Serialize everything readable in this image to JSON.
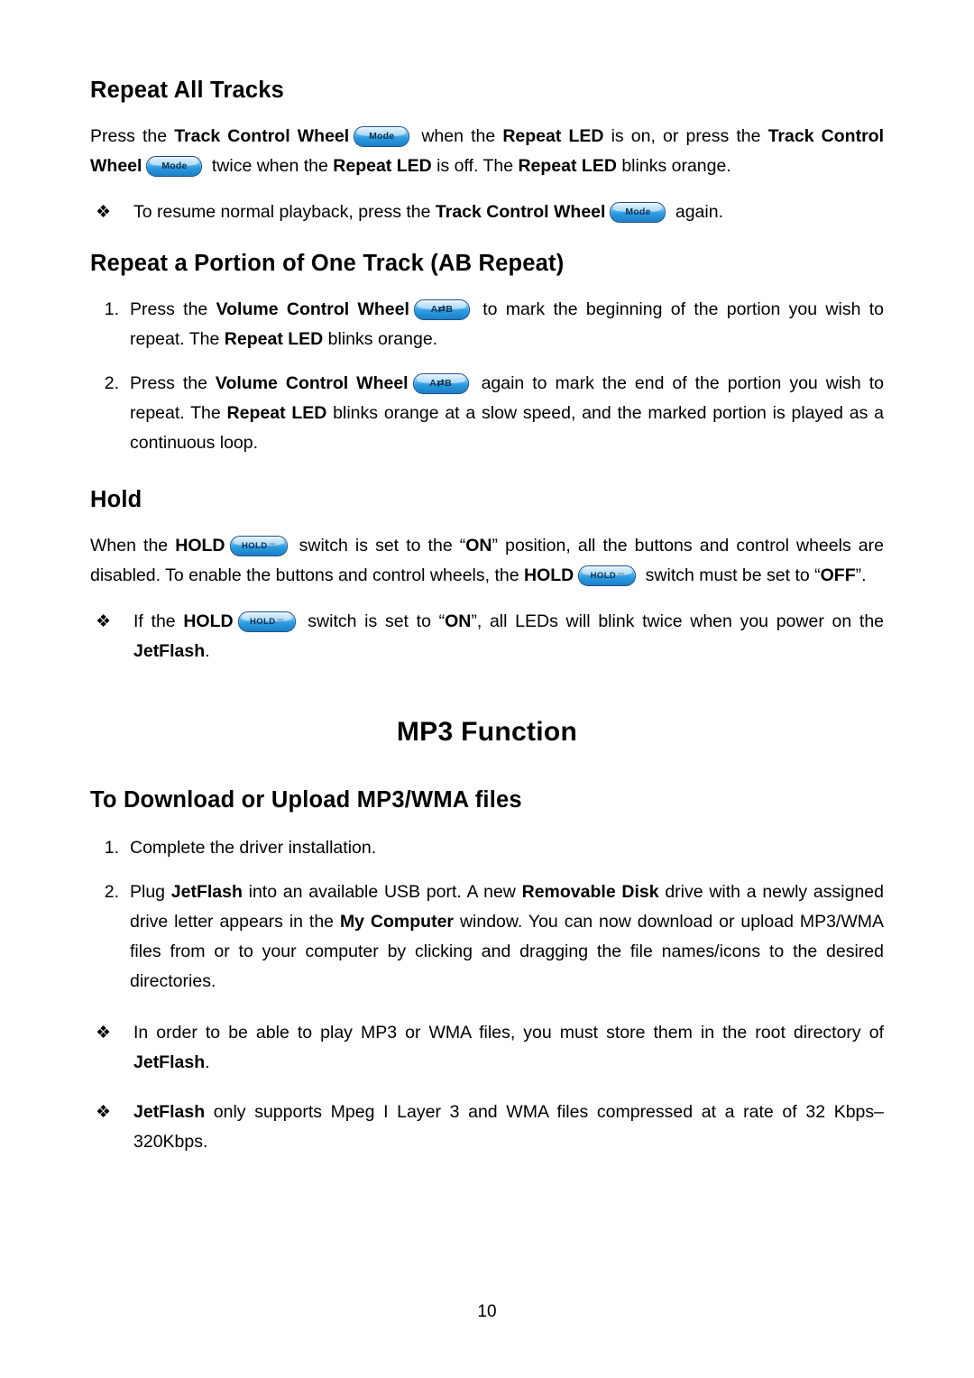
{
  "page": {
    "number": "10"
  },
  "sections": {
    "repeat_all": {
      "title": "Repeat All Tracks",
      "para1_a": "Press the ",
      "para1_b": "Track Control Wheel",
      "para1_c": " when the ",
      "para1_d": "Repeat LED",
      "para1_e": " is on, or press the ",
      "para1_f": "Track Control Wheel",
      "para1_g": " twice when the ",
      "para1_h": "Repeat LED",
      "para1_i": " is off. The ",
      "para1_j": "Repeat LED",
      "para1_k": " blinks orange.",
      "bullet1_a": "To resume normal playback, press the ",
      "bullet1_b": "Track Control Wheel",
      "bullet1_c": " again."
    },
    "ab_repeat": {
      "title": "Repeat a Portion of One Track (AB Repeat)",
      "item1_num": "1.",
      "item1_a": "Press the ",
      "item1_b": "Volume Control Wheel",
      "item1_c": " to mark the beginning of the portion you wish to repeat. The ",
      "item1_d": "Repeat LED",
      "item1_e": " blinks orange.",
      "item2_num": "2.",
      "item2_a": "Press the ",
      "item2_b": "Volume Control Wheel",
      "item2_c": " again to mark the end of the portion you wish to repeat. The ",
      "item2_d": "Repeat LED",
      "item2_e": " blinks orange at a slow speed, and the marked portion is played as a continuous loop."
    },
    "hold": {
      "title": "Hold",
      "para_a": "When the ",
      "para_b": "HOLD",
      "para_c": " switch is set to the “",
      "para_d": "ON",
      "para_e": "” position, all the buttons and control wheels are disabled. To enable the buttons and control wheels, the ",
      "para_f": "HOLD",
      "para_g": " switch must be set to “",
      "para_h": "OFF",
      "para_i": "”.",
      "bullet_a": "If the ",
      "bullet_b": "HOLD",
      "bullet_c": " switch is set to “",
      "bullet_d": "ON",
      "bullet_e": "”, all LEDs will blink twice when you power on the ",
      "bullet_f": "JetFlash",
      "bullet_g": "."
    },
    "mp3_function": {
      "title": "MP3 Function",
      "sub_title": "To Download or Upload MP3/WMA files",
      "item1_num": "1.",
      "item1_text": "Complete the driver installation.",
      "item2_num": "2.",
      "item2_a": "Plug ",
      "item2_b": "JetFlash",
      "item2_c": " into an available USB port. A new ",
      "item2_d": "Removable Disk",
      "item2_e": " drive with a newly assigned drive letter appears in the ",
      "item2_f": "My Computer",
      "item2_g": " window. You can now download or upload MP3/WMA files from or to your computer by clicking and dragging the file names/icons to the desired directories.",
      "bullet1_a": "In order to be able to play MP3 or WMA files, you must store them in the root directory of ",
      "bullet1_b": "JetFlash",
      "bullet1_c": ".",
      "bullet2_a": "JetFlash",
      "bullet2_b": " only supports Mpeg I Layer 3 and WMA files compressed at a rate of 32 Kbps–320Kbps."
    }
  },
  "glyphs": {
    "bullet_diamond": "❖",
    "mode_button_label": "Mode",
    "ab_button_label": "A⇄B",
    "hold_button_label": "HOLD"
  }
}
